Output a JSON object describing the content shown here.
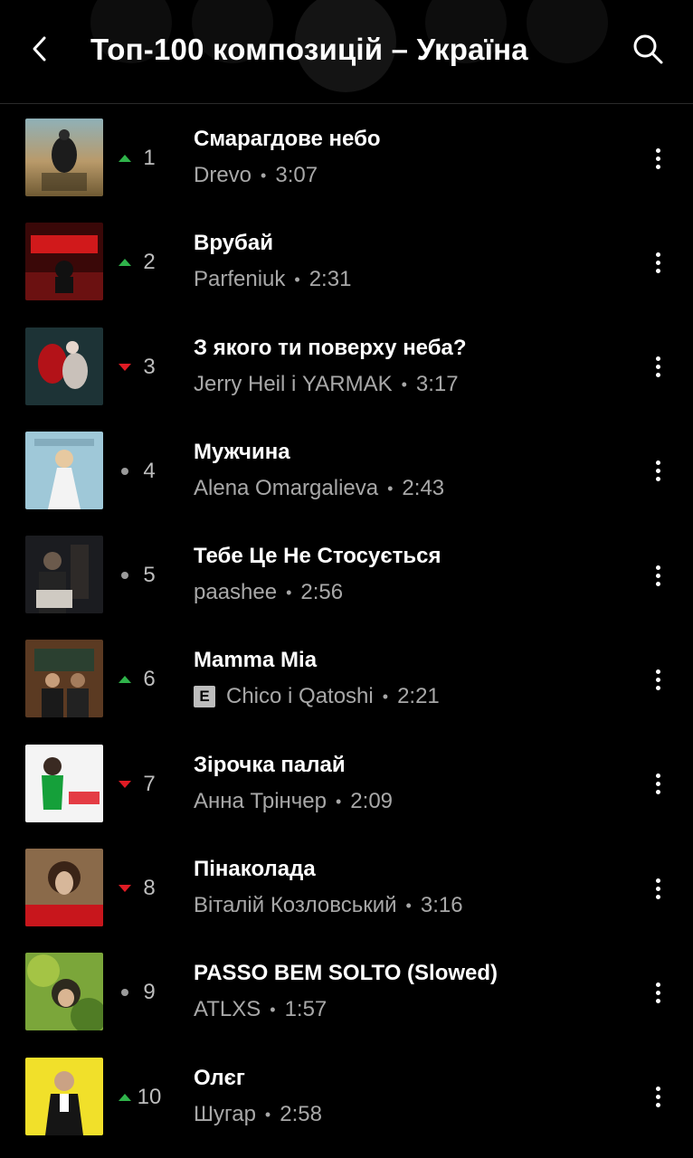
{
  "header": {
    "title": "Топ-100 композицій – Україна",
    "back_icon": "chevron-left-icon",
    "search_icon": "search-icon"
  },
  "colors": {
    "up": "#2fb34a",
    "down": "#e01b24",
    "same": "#9a9a9a",
    "background": "#000000"
  },
  "tracks": [
    {
      "rank": "1",
      "trend": "up",
      "title": "Смарагдове небо",
      "artist": "Drevo",
      "duration": "3:07",
      "explicit": false
    },
    {
      "rank": "2",
      "trend": "up",
      "title": "Врубай",
      "artist": "Parfeniuk",
      "duration": "2:31",
      "explicit": false
    },
    {
      "rank": "3",
      "trend": "down",
      "title": "З якого ти поверху неба?",
      "artist": "Jerry Heil і YARMAK",
      "duration": "3:17",
      "explicit": false
    },
    {
      "rank": "4",
      "trend": "same",
      "title": "Мужчина",
      "artist": "Alena Omargalieva",
      "duration": "2:43",
      "explicit": false
    },
    {
      "rank": "5",
      "trend": "same",
      "title": "Тебе Це Не Стосується",
      "artist": "paashee",
      "duration": "2:56",
      "explicit": false
    },
    {
      "rank": "6",
      "trend": "up",
      "title": "Mamma Mia",
      "artist": "Chico і Qatoshi",
      "duration": "2:21",
      "explicit": true,
      "explicit_label": "E"
    },
    {
      "rank": "7",
      "trend": "down",
      "title": "Зірочка палай",
      "artist": "Анна Трінчер",
      "duration": "2:09",
      "explicit": false
    },
    {
      "rank": "8",
      "trend": "down",
      "title": "Пінаколада",
      "artist": "Віталій Козловський",
      "duration": "3:16",
      "explicit": false
    },
    {
      "rank": "9",
      "trend": "same",
      "title": "PASSO BEM SOLTO (Slowed)",
      "artist": "ATLXS",
      "duration": "1:57",
      "explicit": false
    },
    {
      "rank": "10",
      "trend": "up",
      "title": "Олєг",
      "artist": "Шугар",
      "duration": "2:58",
      "explicit": false
    }
  ],
  "separator": "•"
}
